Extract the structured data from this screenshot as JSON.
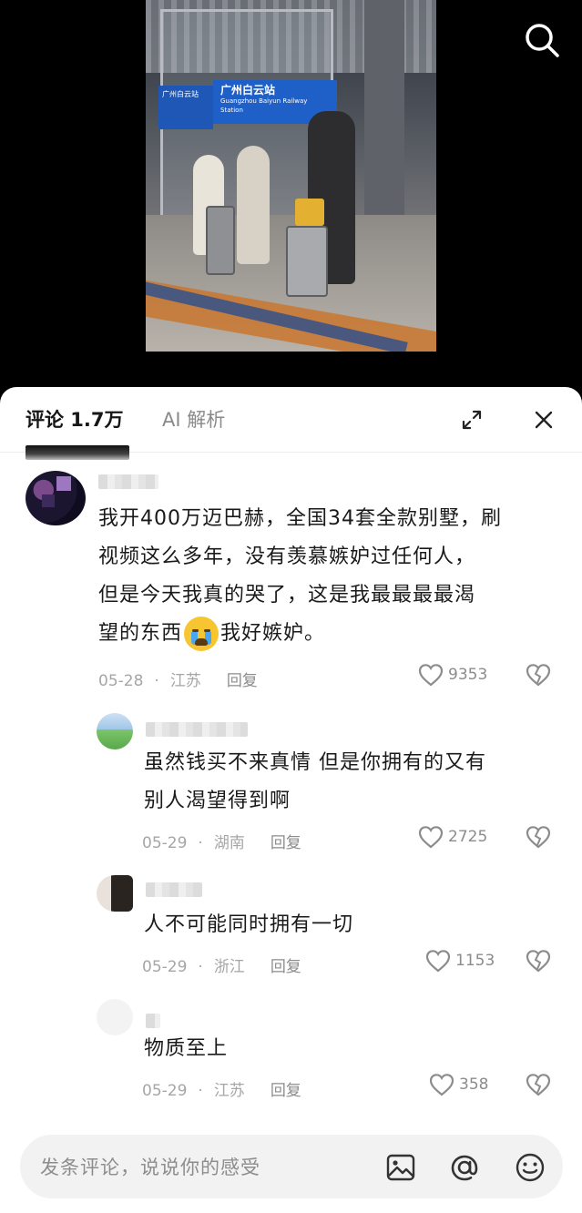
{
  "video": {
    "sign_main": "广州白云站",
    "sign_sub": "Guangzhou Baiyun Railway Station",
    "sign_left": "广州白云站"
  },
  "tabs": {
    "comments": "评论 1.7万",
    "ai": "AI 解析"
  },
  "comments": [
    {
      "text_line1": "我开400万迈巴赫，全国34套全款别墅，刷",
      "text_line2": "视频这么多年，没有羡慕嫉妒过任何人，",
      "text_line3": "但是今天我真的哭了，这是我最最最最渴",
      "text_line4a": "望的东西",
      "text_line4b": "我好嫉妒。",
      "date": "05-28",
      "region": "江苏",
      "reply": "回复",
      "likes": "9353"
    },
    {
      "text_line1": "虽然钱买不来真情 但是你拥有的又有",
      "text_line2": "别人渴望得到啊",
      "date": "05-29",
      "region": "湖南",
      "reply": "回复",
      "likes": "2725"
    },
    {
      "text_line1": "人不可能同时拥有一切",
      "date": "05-29",
      "region": "浙江",
      "reply": "回复",
      "likes": "1153"
    },
    {
      "text_line1": "物质至上",
      "date": "05-29",
      "region": "江苏",
      "reply": "回复",
      "likes": "358"
    }
  ],
  "input": {
    "placeholder": "发条评论，说说你的感受"
  },
  "dot": "·"
}
